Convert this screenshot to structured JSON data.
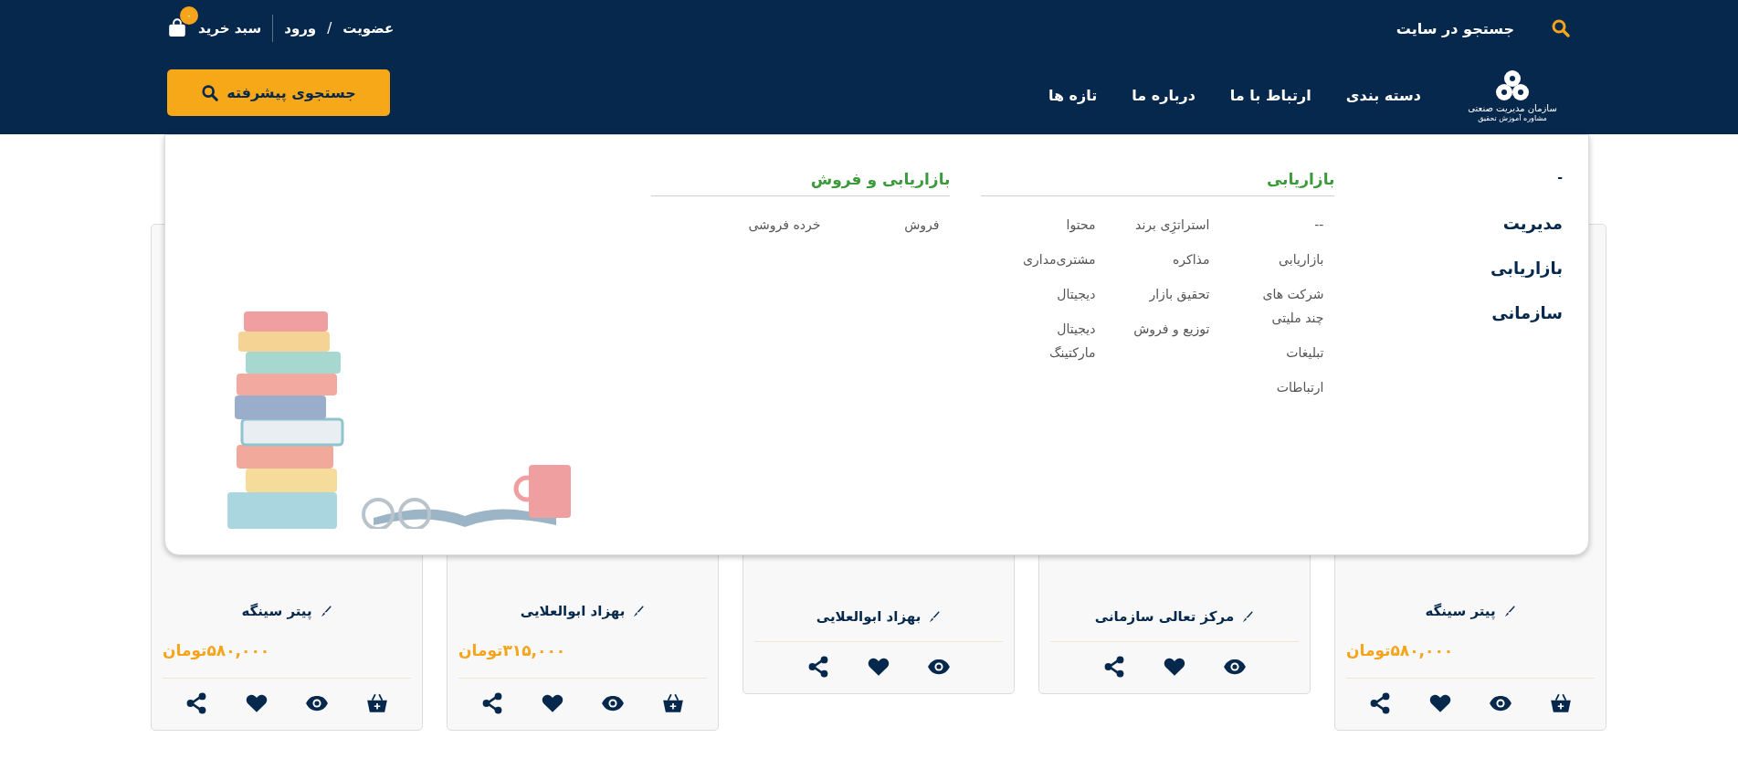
{
  "header": {
    "search_label": "جستجو در سایت",
    "auth": {
      "register": "عضویت",
      "separator": "/",
      "login": "ورود"
    },
    "cart": {
      "label": "سبد خرید",
      "count": "۰"
    },
    "logo": {
      "title": "سازمان مدیریت صنعتی",
      "subtitle": "مشاوره آموزش تحقیق"
    },
    "nav": [
      "دسته بندی",
      "ارتباط با ما",
      "درباره ما",
      "تازه ها"
    ],
    "advanced_search": "جستجوی پیشرفته"
  },
  "mega_menu": {
    "top_item": "-",
    "categories": [
      "مدیریت",
      "بازاریابی",
      "سازمانی"
    ],
    "sections": [
      {
        "title": "بازاریابی",
        "columns": [
          [
            "--",
            "بازاریابی",
            "شرکت های چند ملیتی",
            "تبلیغات",
            "ارتباطات"
          ],
          [
            "استراتژِی برند",
            "مذاکره",
            "تحقیق بازار",
            "توزیع و فروش"
          ],
          [
            "محتوا",
            "مشتری‌مداری",
            "دیجیتال",
            "دیجیتال مارکتینگ"
          ]
        ]
      },
      {
        "title": "بازاریابی و فروش",
        "columns": [
          [
            "فروش"
          ],
          [
            "خرده فروشی"
          ]
        ]
      }
    ]
  },
  "cards": [
    {
      "author": "پیتر سینگه",
      "price": "۵۸۰,۰۰۰تومان",
      "actions": [
        {
          "kind": "cart"
        },
        {
          "kind": "view"
        },
        {
          "kind": "like"
        },
        {
          "kind": "share"
        }
      ]
    },
    {
      "author": "مرکز تعالی سازمانی",
      "actions": [
        {
          "kind": "view"
        },
        {
          "kind": "like"
        },
        {
          "kind": "share"
        }
      ]
    },
    {
      "author": "بهزاد ابوالعلایی",
      "actions": [
        {
          "kind": "view"
        },
        {
          "kind": "like"
        },
        {
          "kind": "share"
        }
      ]
    },
    {
      "author": "بهزاد ابوالعلایی",
      "price": "۳۱۵,۰۰۰تومان",
      "actions": [
        {
          "kind": "cart"
        },
        {
          "kind": "view"
        },
        {
          "kind": "like"
        },
        {
          "kind": "share"
        }
      ]
    },
    {
      "author": "پیتر سینگه",
      "price": "۵۸۰,۰۰۰تومان",
      "actions": [
        {
          "kind": "cart"
        },
        {
          "kind": "view"
        },
        {
          "kind": "like"
        },
        {
          "kind": "share"
        }
      ]
    }
  ]
}
